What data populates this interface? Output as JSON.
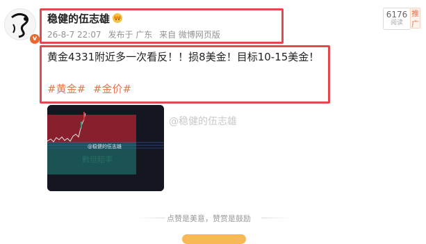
{
  "author": {
    "name": "稳健的伍志雄",
    "avatar_badge": "v",
    "vip_icon": "crown-icon"
  },
  "meta": {
    "date": "26-8-7 22:07",
    "posted_from": "发布于 广东",
    "source": "来自 微博网页版"
  },
  "post": {
    "text": "黄金4331附近多一次看反！！损8美金！目标10-15美金！",
    "tags": [
      "#黄金#",
      "#金价#"
    ]
  },
  "stats": {
    "reads": "6176",
    "reads_label": "阅读",
    "promote": "推广"
  },
  "image": {
    "watermark_inner": "@稳健的伍志雄",
    "watermark_outer": "@稳健的伍志雄"
  },
  "footer": {
    "tip": "点赞是美意，赞赏是鼓励"
  },
  "colors": {
    "highlight": "#e4484f",
    "tag": "#eb7350",
    "chart_bg": "#141620",
    "red_zone": "#9b2130",
    "green_zone": "#1b5a56"
  }
}
